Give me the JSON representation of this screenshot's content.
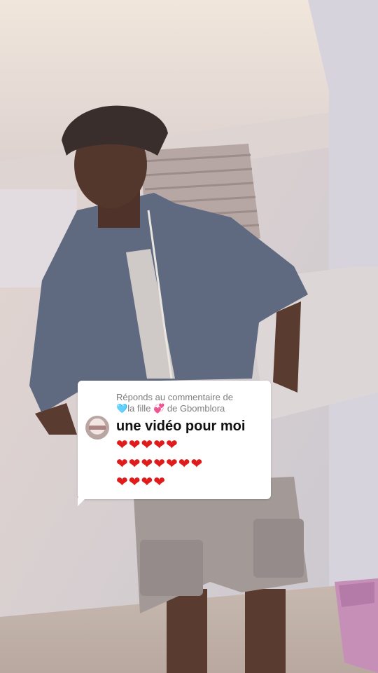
{
  "reply": {
    "prefix": "Réponds au commentaire de",
    "commenter_part1": "la fille",
    "commenter_part2": "de Gbomblora",
    "emoji_before_name": "🩵",
    "emoji_in_name": "💞",
    "comment": "une vidéo pour moi",
    "hearts_line1": "❤❤❤❤❤",
    "hearts_line2": "❤❤❤❤❤❤❤",
    "hearts_line3": "❤❤❤❤",
    "avatar_icon": "commenter-avatar"
  },
  "colors": {
    "card_background": "#ffffff",
    "muted_text": "#7d7d7d",
    "heart_red": "#e01b1b"
  }
}
